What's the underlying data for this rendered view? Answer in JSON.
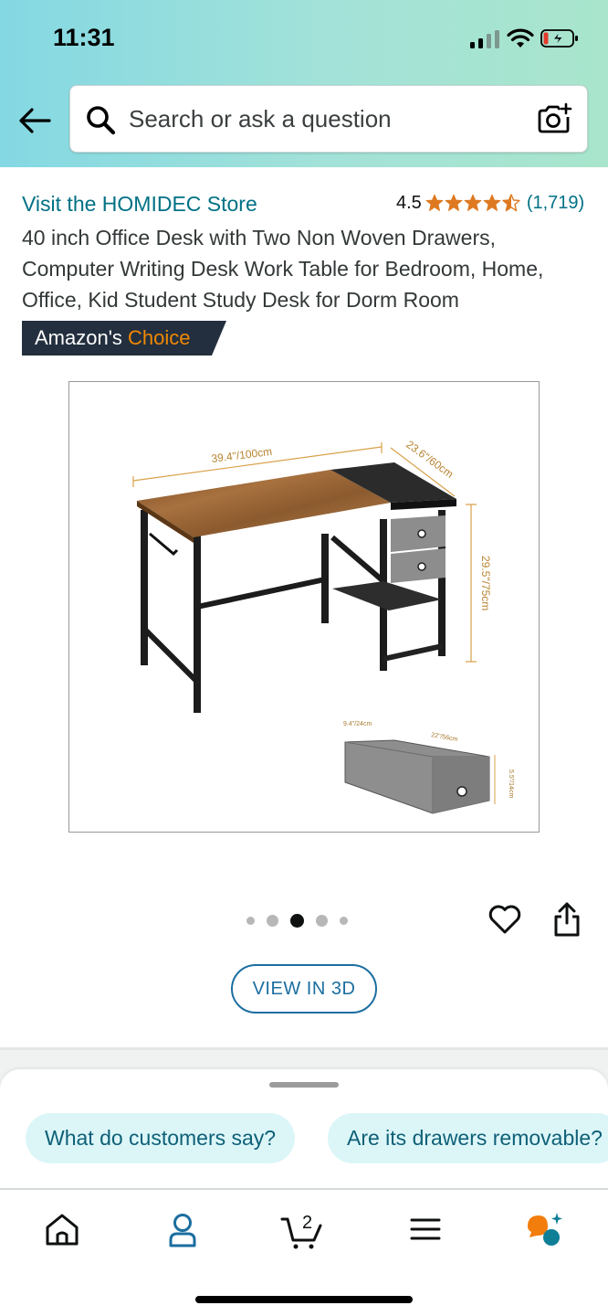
{
  "status_bar": {
    "time": "11:31"
  },
  "search": {
    "placeholder": "Search or ask a question",
    "value": ""
  },
  "icons": {
    "back": "arrow-left-icon",
    "search": "search-icon",
    "camera": "camera-icon",
    "star": "star-icon",
    "heart": "heart-icon",
    "share": "share-icon",
    "home": "home-icon",
    "account": "account-icon",
    "cart": "cart-icon",
    "menu": "menu-icon",
    "rufus": "rufus-icon"
  },
  "product": {
    "store_link": "Visit the HOMIDEC Store",
    "rating": "4.5",
    "stars": 4.5,
    "review_count": "(1,719)",
    "title": "40 inch Office Desk with Two Non Woven Drawers, Computer Writing Desk Work Table for Bedroom, Home, Office, Kid Student Study Desk for Dorm Room",
    "badge": {
      "prefix": "Amazon's",
      "highlight": "Choice"
    }
  },
  "image": {
    "dim_width": "39.4\"/100cm",
    "dim_depth": "23.6\"/60cm",
    "dim_height": "29.5\"/75cm",
    "drawer_depth": "9.4\"/24cm",
    "drawer_length": "22\"/56cm",
    "drawer_height": "5.5\"/14cm"
  },
  "carousel": {
    "total": 5,
    "active_index": 2
  },
  "view_3d": "VIEW IN 3D",
  "suggestions": [
    {
      "label": "What do customers say?"
    },
    {
      "label": "Are its drawers removable?"
    }
  ],
  "bottom_nav": {
    "cart_count": "2"
  },
  "colors": {
    "link": "#007185",
    "star": "#de7921",
    "badge_bg": "#232f3e",
    "badge_highlight": "#f08804",
    "chip_bg": "#dcf6f8",
    "view3d": "#1b6ea0",
    "nav_icon": "#0f1111",
    "account_icon": "#1b6ea0",
    "rufus_orange": "#f27d0c",
    "rufus_teal": "#0e7f96"
  }
}
